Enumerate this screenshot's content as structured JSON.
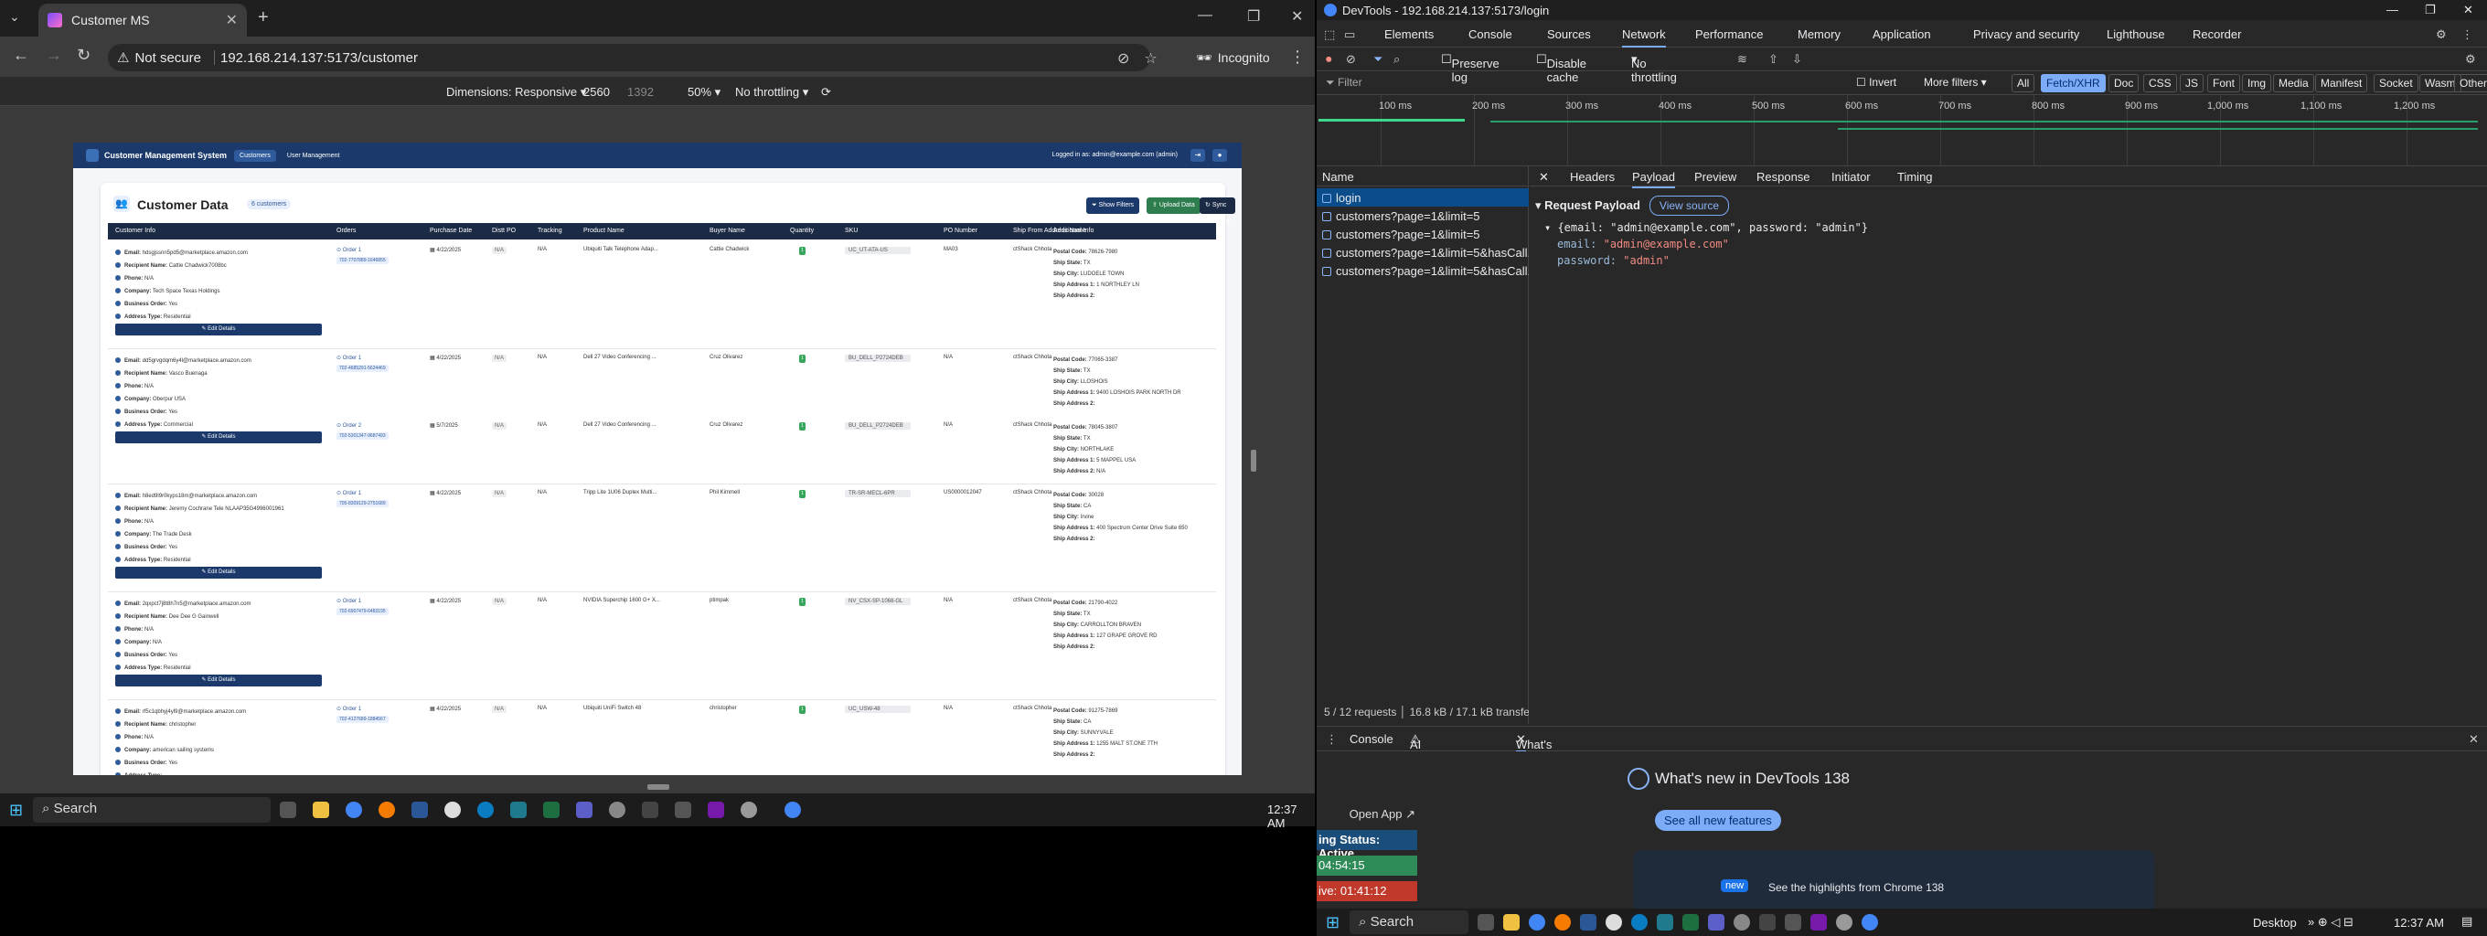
{
  "browser": {
    "tab_title": "Customer MS",
    "new_tab": "+",
    "security": "Not secure",
    "url": "192.168.214.137:5173/customer",
    "incognito": "Incognito",
    "device": {
      "dimensions_label": "Dimensions: Responsive",
      "width": "2560",
      "height": "1392",
      "zoom": "50%",
      "throttle": "No throttling"
    }
  },
  "app": {
    "brand": "Customer Management System",
    "nav": [
      "Customers",
      "User Management"
    ],
    "logged_in": "Logged in as: admin@example.com (admin)",
    "title": "Customer Data",
    "count_badge": "6 customers",
    "buttons": {
      "filters": "Show Filters",
      "upload": "Upload Data",
      "sync": "Sync Tracking"
    },
    "columns": [
      "Customer Info",
      "Orders",
      "Purchase Date",
      "Distt PO",
      "Tracking",
      "Product Name",
      "Buyer Name",
      "Quantity",
      "SKU",
      "PO Number",
      "Ship From Address Name",
      "Additional Info"
    ],
    "edit_label": "Edit Details",
    "info_labels": {
      "email": "Email:",
      "recipient": "Recipient Name:",
      "phone": "Phone:",
      "company": "Company:",
      "business": "Business Order:",
      "address": "Address Type:"
    },
    "addl_labels": {
      "postal": "Postal Code:",
      "state": "Ship State:",
      "city": "Ship City:",
      "addr1": "Ship Address 1:",
      "addr2": "Ship Address 2:"
    },
    "rows": [
      {
        "email": "hdsgjssnn5pd5@marketplace.amazon.com",
        "recipient": "Cattie Chadwick7008bc",
        "phone": "N/A",
        "company": "Tech Space Texas Holdings",
        "business": "Yes",
        "address": "Residential",
        "orders": [
          {
            "label": "Order 1",
            "id": "702-7707889-1646855",
            "date": "4/22/2025",
            "distt": "N/A",
            "tracking": "N/A",
            "product": "Ubiquiti Talk Telephone Adap...",
            "buyer": "Cattie Chadwick",
            "qty": "1",
            "sku": "UC_UT-ATA-US",
            "po": "MA03",
            "ship_from": "ctShack Chhota",
            "postal": "78626-7980",
            "st": "TX",
            "city": "LUDOELE TOWN",
            "a1": "1 NORTHLEY LN",
            "a2": ""
          }
        ]
      },
      {
        "email": "dd5grvgdqm6y4l@marketplace.amazon.com",
        "recipient": "Vasco Buenaga",
        "phone": "N/A",
        "company": "Oberpur USA",
        "business": "Yes",
        "address": "Commercial",
        "orders": [
          {
            "label": "Order 1",
            "id": "702-4685291-5624469",
            "date": "4/22/2025",
            "distt": "N/A",
            "tracking": "N/A",
            "product": "Dell 27 Video Conferencing ...",
            "buyer": "Cruz Olivarez",
            "qty": "1",
            "sku": "BU_DELL_P2724DEB",
            "po": "N/A",
            "ship_from": "ctShack Chhota",
            "postal": "77065-3387",
            "st": "TX",
            "city": "LLOSHOIS",
            "a1": "9400 LOSHOIS PARK NORTH DR",
            "a2": ""
          },
          {
            "label": "Order 2",
            "id": "702-5301347-9687493",
            "date": "5/7/2025",
            "distt": "N/A",
            "tracking": "N/A",
            "product": "Dell 27 Video Conferencing ...",
            "buyer": "Cruz Olivarez",
            "qty": "1",
            "sku": "BU_DELL_P2724DEB",
            "po": "N/A",
            "ship_from": "ctShack Chhota",
            "postal": "78045-3807",
            "st": "TX",
            "city": "NORTHLAKE",
            "a1": "5 MAPPEL USA",
            "a2": "N/A"
          }
        ]
      },
      {
        "email": "h8ed9l9r0kyps18m@marketplace.amazon.com",
        "recipient": "Jeremy Cochrane Tele NLAAP35G4996001961",
        "phone": "N/A",
        "company": "The Trade Desk",
        "business": "Yes",
        "address": "Residential",
        "orders": [
          {
            "label": "Order 1",
            "id": "705-8309129-2751689",
            "date": "4/22/2025",
            "distt": "N/A",
            "tracking": "N/A",
            "product": "Tripp Lite 1U06 Duplex Multi...",
            "buyer": "Phil Kimmell",
            "qty": "1",
            "sku": "TR-SR-MECL-6PR",
            "po": "US0000012047",
            "ship_from": "ctShack Chhota",
            "postal": "30028",
            "st": "CA",
            "city": "Irvine",
            "a1": "400 Spectrum Center Drive Suite 650",
            "a2": ""
          }
        ]
      },
      {
        "email": "2qxpct7j8t8h7n5@marketplace.amazon.com",
        "recipient": "Dee Dee G Gainwell",
        "phone": "N/A",
        "company": "N/A",
        "business": "Yes",
        "address": "Residential",
        "orders": [
          {
            "label": "Order 1",
            "id": "702-6907479-6483195",
            "date": "4/22/2025",
            "distt": "N/A",
            "tracking": "N/A",
            "product": "NVIDIA Superchip 1600 G+ X...",
            "buyer": "ptimpak",
            "qty": "1",
            "sku": "NV_CSX-SP-1068-GL",
            "po": "N/A",
            "ship_from": "ctShack Chhota",
            "postal": "21790-4022",
            "st": "TX",
            "city": "CARROLLTON BRAVEN",
            "a1": "127 GRAPE GROVE RD",
            "a2": ""
          }
        ]
      },
      {
        "email": "rf5c1qbhyj4yl9@marketplace.amazon.com",
        "recipient": "christopher",
        "phone": "N/A",
        "company": "american sailing systems",
        "business": "Yes",
        "address": "",
        "orders": [
          {
            "label": "Order 1",
            "id": "702-4127689-1884567",
            "date": "4/22/2025",
            "distt": "N/A",
            "tracking": "N/A",
            "product": "Ubiquiti UniFi Switch 48",
            "buyer": "christopher",
            "qty": "1",
            "sku": "UC_USW-48",
            "po": "N/A",
            "ship_from": "ctShack Chhota",
            "postal": "91275-7869",
            "st": "CA",
            "city": "SUNNYVALE",
            "a1": "1255 MALT ST.ONE 7TH",
            "a2": ""
          }
        ]
      }
    ]
  },
  "devtools": {
    "title": "DevTools - 192.168.214.137:5173/login",
    "panels": [
      "Elements",
      "Console",
      "Sources",
      "Network",
      "Performance",
      "Memory",
      "Application",
      "Privacy and security",
      "Lighthouse",
      "Recorder"
    ],
    "active_panel": "Network",
    "preserve_log": "Preserve log",
    "disable_cache": "Disable cache",
    "throttle": "No throttling",
    "filter_placeholder": "Filter",
    "invert": "Invert",
    "more_filters": "More filters",
    "types": [
      "All",
      "Fetch/XHR",
      "Doc",
      "CSS",
      "JS",
      "Font",
      "Img",
      "Media",
      "Manifest",
      "Socket",
      "Wasm",
      "Other"
    ],
    "active_type": "Fetch/XHR",
    "ticks": [
      "100 ms",
      "200 ms",
      "300 ms",
      "400 ms",
      "500 ms",
      "600 ms",
      "700 ms",
      "800 ms",
      "900 ms",
      "1,000 ms",
      "1,100 ms",
      "1,200 ms"
    ],
    "name_header": "Name",
    "requests": [
      "login",
      "customers?page=1&limit=5",
      "customers?page=1&limit=5",
      "customers?page=1&limit=5&hasCall...",
      "customers?page=1&limit=5&hasCall..."
    ],
    "status": "5 / 12 requests",
    "transfer": "16.8 kB / 17.1 kB transfe",
    "detail_tabs": [
      "Headers",
      "Payload",
      "Preview",
      "Response",
      "Initiator",
      "Timing"
    ],
    "active_detail": "Payload",
    "payload_title": "Request Payload",
    "view_source": "View source",
    "payload_summary": "{email: \"admin@example.com\", password: \"admin\"}",
    "payload_email_key": "email:",
    "payload_email_val": "\"admin@example.com\"",
    "payload_pw_key": "password:",
    "payload_pw_val": "\"admin\"",
    "drawer_tabs": [
      "Console",
      "AI assistance",
      "What's new"
    ],
    "whats_new_title": "What's new in DevTools 138",
    "see_all": "See all new features",
    "highlights": "See the highlights from Chrome 138",
    "new_badge": "new",
    "open_app": "Open App",
    "status_active": "ing Status: Active",
    "time1": "04:54:15",
    "time2": "ive: 01:41:12"
  },
  "taskbar": {
    "search": "Search",
    "time": "12:37 AM",
    "desktop": "Desktop"
  }
}
